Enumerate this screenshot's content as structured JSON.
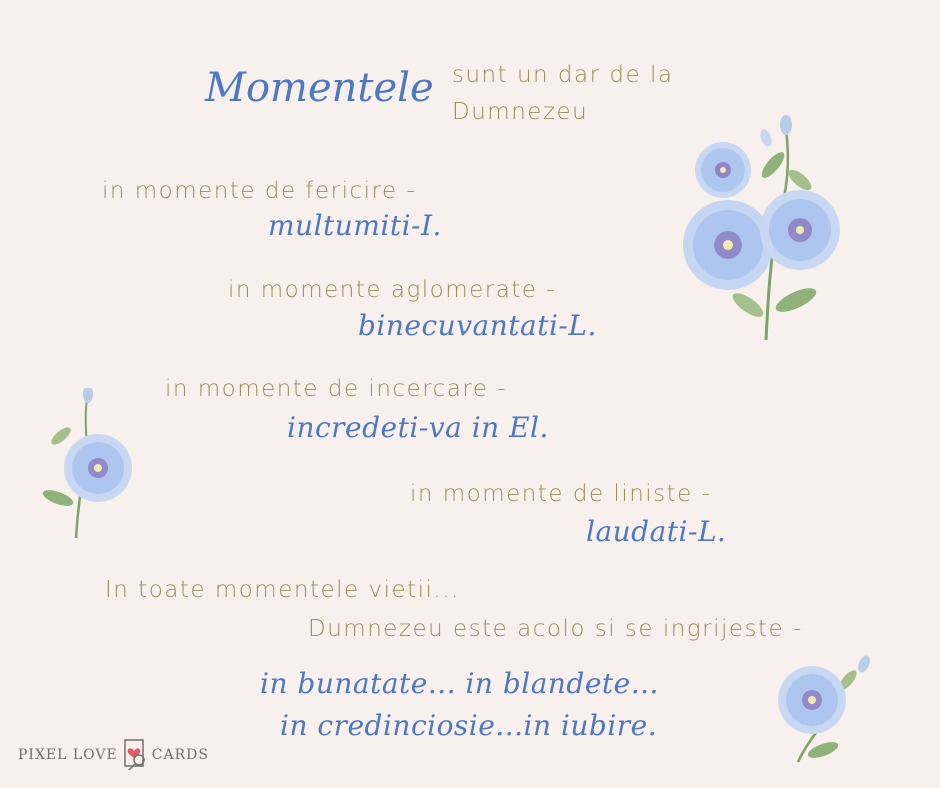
{
  "title": {
    "script": "Momentele",
    "line1": "sunt un dar de la",
    "line2": "Dumnezeu"
  },
  "verses": [
    {
      "lead": "in momente de fericire -",
      "response": "multumiti-I."
    },
    {
      "lead": "in momente aglomerate -",
      "response": "binecuvantati-L."
    },
    {
      "lead": "in momente de incercare -",
      "response": "incredeti-va in El."
    },
    {
      "lead": "in momente de liniste -",
      "response": "laudati-L."
    }
  ],
  "closing": {
    "line1": "In toate momentele vietii...",
    "line2": "Dumnezeu este acolo si se ingrijeste -",
    "script1": "in bunatate... in blandete...",
    "script2": "in credinciosie...in iubire."
  },
  "logo": {
    "left": "PIXEL LOVE",
    "right": "CARDS"
  },
  "colors": {
    "background": "#f8f0ec",
    "script_text": "#4f78c2",
    "sans_text": "#9c8c5c",
    "petal": "#a9c3ee",
    "petal_center": "#7a5aa8",
    "leaf": "#7ea36a"
  },
  "icons": [
    "hibiscus-flower-icon",
    "pixel-love-cards-logo-icon"
  ]
}
